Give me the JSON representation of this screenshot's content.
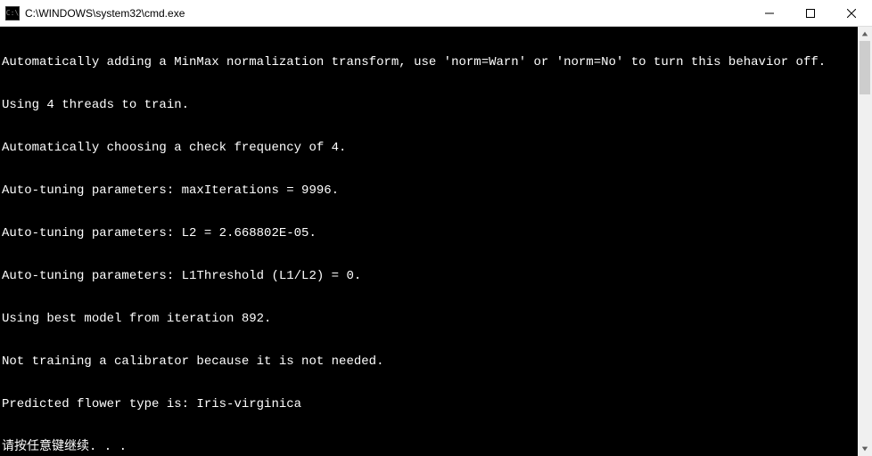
{
  "titlebar": {
    "icon_label": "C:\\",
    "title": "C:\\WINDOWS\\system32\\cmd.exe"
  },
  "console": {
    "lines": [
      "Automatically adding a MinMax normalization transform, use 'norm=Warn' or 'norm=No' to turn this behavior off.",
      "Using 4 threads to train.",
      "Automatically choosing a check frequency of 4.",
      "Auto-tuning parameters: maxIterations = 9996.",
      "Auto-tuning parameters: L2 = 2.668802E-05.",
      "Auto-tuning parameters: L1Threshold (L1/L2) = 0.",
      "Using best model from iteration 892.",
      "Not training a calibrator because it is not needed.",
      "Predicted flower type is: Iris-virginica",
      "请按任意键继续. . ."
    ]
  }
}
